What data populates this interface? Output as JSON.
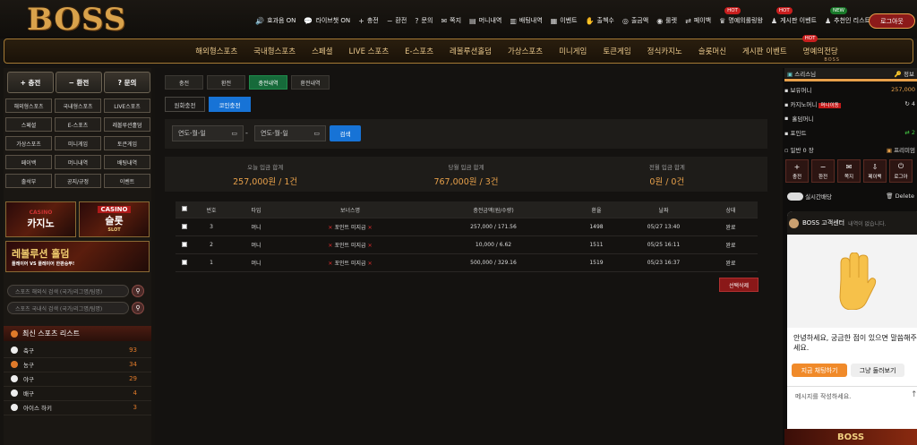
{
  "logo": "BOSS",
  "top_links": [
    {
      "icon": "speaker-icon",
      "glyph": "🔊",
      "label": "효과음 ON"
    },
    {
      "icon": "chat-icon",
      "glyph": "💬",
      "label": "라이브챗 ON"
    },
    {
      "icon": "plus-icon",
      "glyph": "+",
      "label": "충전"
    },
    {
      "icon": "minus-icon",
      "glyph": "−",
      "label": "환전"
    },
    {
      "icon": "question-icon",
      "glyph": "?",
      "label": "문의"
    },
    {
      "icon": "mail-icon",
      "glyph": "✉",
      "label": "쪽지"
    },
    {
      "icon": "money-icon",
      "glyph": "▤",
      "label": "머니내역"
    },
    {
      "icon": "bet-icon",
      "glyph": "▥",
      "label": "배팅내역"
    },
    {
      "icon": "calendar-icon",
      "glyph": "▦",
      "label": "이벤트"
    },
    {
      "icon": "hand-icon",
      "glyph": "✋",
      "label": "출첵수"
    },
    {
      "icon": "coin-icon",
      "glyph": "◎",
      "label": "출금액"
    },
    {
      "icon": "roulette-icon",
      "glyph": "◉",
      "label": "룰렛"
    },
    {
      "icon": "payback-icon",
      "glyph": "⇄",
      "label": "페이백"
    },
    {
      "icon": "trophy-icon",
      "glyph": "♛",
      "label": "명예의롤링왕",
      "badge": "HOT"
    },
    {
      "icon": "board-icon",
      "glyph": "♟",
      "label": "게시판 이벤트",
      "badge": "HOT"
    },
    {
      "icon": "user-icon",
      "glyph": "♟",
      "label": "추천인 리스트",
      "badge": "NEW"
    }
  ],
  "login_label": "로그아웃",
  "nav": [
    "해외형스포츠",
    "국내형스포츠",
    "스페셜",
    "LIVE 스포츠",
    "E-스포츠",
    "레볼루션홀덤",
    "가상스포츠",
    "미니게임",
    "토큰게임",
    "정식카지노",
    "슬롯머신",
    "게시판 이벤트",
    "명예의전당"
  ],
  "nav_hot": "HOT",
  "nav_sub": "BOSS",
  "left": {
    "big_buttons": [
      "+ 충전",
      "− 환전",
      "? 문의"
    ],
    "grid": [
      "해외형스포츠",
      "국내형스포츠",
      "LIVE스포츠",
      "스페셜",
      "E-스포츠",
      "레볼루션홀덤",
      "가상스포츠",
      "미니게임",
      "토큰게임",
      "페이백",
      "머니내역",
      "배팅내역",
      "출석부",
      "공지/규정",
      "이벤트"
    ],
    "casino_banner": "카지노",
    "casino_sub": "CASINO",
    "slot_banner": "슬롯",
    "slot_tag": "CASINO",
    "slot_sub": "SLOT",
    "revolution_banner": "레볼루션 홀덤",
    "revolution_sub": "플레이어 VS 플레이어 한판승부!",
    "search1_placeholder": "스포츠 해외식 검색 (국가/리그명/팀명)",
    "search2_placeholder": "스포츠 국내식 검색 (국가/리그명/팀명)",
    "sports_header": "최신 스포츠 리스트",
    "sports": [
      {
        "name": "축구",
        "count": "93"
      },
      {
        "name": "농구",
        "count": "34"
      },
      {
        "name": "야구",
        "count": "29"
      },
      {
        "name": "배구",
        "count": "4"
      },
      {
        "name": "아이스 하키",
        "count": "3"
      }
    ]
  },
  "main": {
    "tabs": [
      "충전",
      "환전",
      "충전내역",
      "환전내역"
    ],
    "subtabs": [
      "원화충전",
      "코인충전"
    ],
    "date_from": "연도-월-일",
    "date_sep": "-",
    "date_to": "연도-월-일",
    "search_label": "검색",
    "summary": [
      {
        "label": "오늘 입금 합계",
        "value": "257,000원 / 1건"
      },
      {
        "label": "당월 입금 합계",
        "value": "767,000원 / 3건"
      },
      {
        "label": "전월 입금 합계",
        "value": "0원 / 0건"
      }
    ],
    "table_headers": [
      "번호",
      "타입",
      "보너스명",
      "충전금액(원/수량)",
      "환율",
      "날짜",
      "상태"
    ],
    "rows": [
      {
        "no": "3",
        "type": "머니",
        "bonus": "포인트 미지급",
        "amount": "257,000 / 171.56",
        "rate": "1498",
        "date": "05/27 13:40",
        "status": "완료"
      },
      {
        "no": "2",
        "type": "머니",
        "bonus": "포인트 미지급",
        "amount": "10,000 / 6.62",
        "rate": "1511",
        "date": "05/25 16:11",
        "status": "완료"
      },
      {
        "no": "1",
        "type": "머니",
        "bonus": "포인트 미지급",
        "amount": "500,000 / 329.16",
        "rate": "1519",
        "date": "05/23 16:37",
        "status": "완료"
      }
    ],
    "delete_label": "선택삭제"
  },
  "right": {
    "row1_a": "스리스님",
    "row1_b": "정보",
    "money_label": "보유머니",
    "money_value": "257,000",
    "casino_money_label": "카지노머니",
    "casino_money_badge": "머니이동",
    "casino_money_value": "4",
    "holdem_label": "홀덤머니",
    "point_label": "포인트",
    "point_value": "2",
    "coupon_label": "일반 0 장",
    "premium_label": "프리미엄",
    "buttons": [
      "충전",
      "환전",
      "쪽지",
      "페이백",
      "로그아"
    ],
    "live_label": "실시간배당",
    "delete_label": "Delete",
    "chat_title": "BOSS 고객센터",
    "chat_sub": "내역이 없습니다.",
    "chat_msg": "안녕하세요, 궁금한 점이 있으면 말씀해주세요.",
    "chat_btn1": "지금 채팅하기",
    "chat_btn2": "그냥 둘러보기",
    "chat_input": "메시지를 작성하세요.",
    "bottom_banner": "BOSS",
    "colors": {
      "accent_orange": "#e7a04a",
      "green_tab": "#166a3a",
      "blue": "#1773d6",
      "red": "#8a1818"
    }
  }
}
